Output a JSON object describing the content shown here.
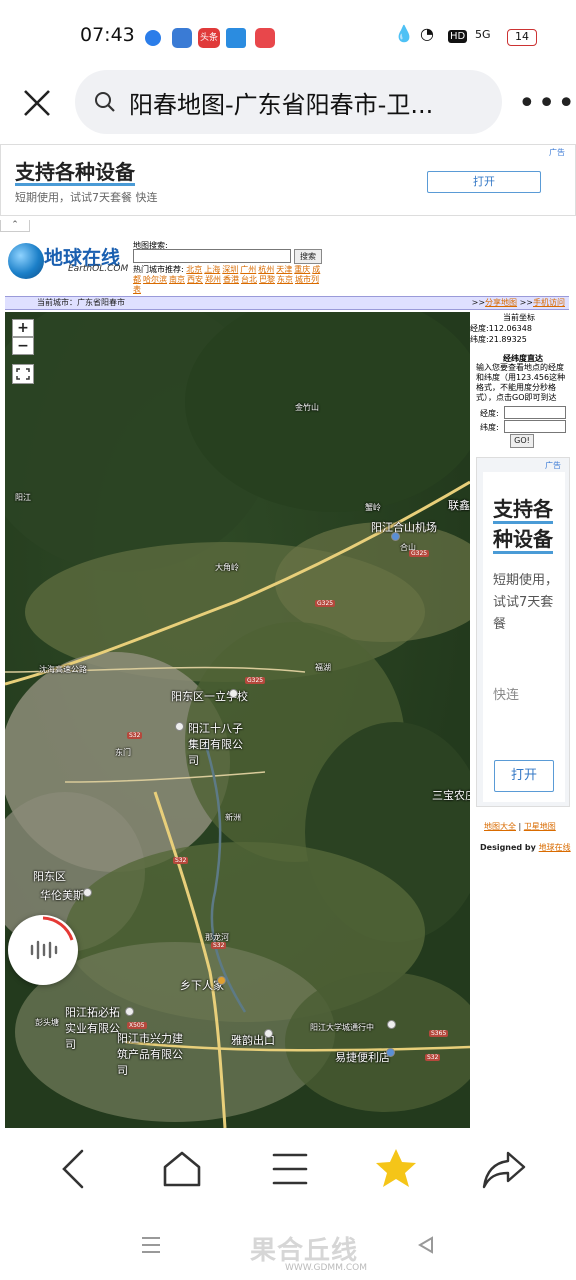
{
  "status_bar": {
    "time": "07:43",
    "headline_badge": "头条",
    "network": "5G",
    "battery": "14",
    "colors": {
      "app1": "#2b7de9",
      "app2": "#3a7bd5",
      "app3": "#e03a3a",
      "app4": "#2b8ce0",
      "app5": "#e8474b"
    }
  },
  "address_bar": {
    "page_title": "阳春地图-广东省阳春市-卫...",
    "icons": [
      "close-icon",
      "search-icon",
      "more-icon"
    ]
  },
  "top_ad": {
    "tag": "广告",
    "heading": "支持各种设备",
    "subtext": "短期使用，试试7天套餐 快连",
    "button": "打开"
  },
  "site": {
    "logo_text": "地球在线",
    "logo_sub": "EarthOL.COM",
    "search_label": "地图搜索:",
    "search_button": "搜索",
    "search_value": "",
    "hot_label": "热门城市推荐:",
    "cities": [
      "北京",
      "上海",
      "深圳",
      "广州",
      "杭州",
      "天津",
      "重庆",
      "成都",
      "哈尔滨",
      "南京",
      "西安",
      "郑州",
      "香港",
      "台北",
      "巴黎",
      "东京",
      "城市列表"
    ],
    "current_city": "当前城市：广东省阳春市",
    "share_link": "分享地图",
    "mobile_link": "手机访问",
    "link_prefix": ">>"
  },
  "side_panel": {
    "coord_title": "当前坐标",
    "lon_text": "经度:112.06348",
    "lat_text": "纬度:21.89325",
    "jump_title": "经纬度直达",
    "jump_desc": "输入您要查看地点的经度和纬度（用123.456这种格式，不能用度分秒格式），点击GO即可到达",
    "lon_label": "经度:",
    "lat_label": "纬度:",
    "lon_value": "",
    "lat_value": "",
    "go_button": "GO!",
    "ad": {
      "tag": "广告",
      "heading": "支持各种设备",
      "subtext": "短期使用，试试7天套餐",
      "brand": "快连",
      "button": "打开"
    },
    "links": [
      "地图大全",
      "卫星地图"
    ],
    "designed_by": "Designed by",
    "designed_link": "地球在线"
  },
  "map": {
    "zoom_in": "+",
    "zoom_out": "−",
    "labels": [
      {
        "text": "阳江合山机场",
        "cls": "big"
      },
      {
        "text": "阳东区一立学校",
        "cls": "big"
      },
      {
        "text": "阳江十八子集团有限公司",
        "cls": "big"
      },
      {
        "text": "阳东区",
        "cls": "big"
      },
      {
        "text": "华伦美斯",
        "cls": "big"
      },
      {
        "text": "乡下人家",
        "cls": "big"
      },
      {
        "text": "阳江拓必拓实业有限公司",
        "cls": "big"
      },
      {
        "text": "阳江市兴力建筑产品有限公司",
        "cls": "big"
      },
      {
        "text": "雅韵出口",
        "cls": "big"
      },
      {
        "text": "阳江大学城通行中",
        "cls": ""
      },
      {
        "text": "易捷便利店",
        "cls": "big"
      },
      {
        "text": "三宝农庄",
        "cls": "big"
      },
      {
        "text": "联鑫",
        "cls": "big"
      },
      {
        "text": "沈海高速公路",
        "cls": ""
      },
      {
        "text": "彭头塘",
        "cls": ""
      },
      {
        "text": "阳江",
        "cls": ""
      },
      {
        "text": "蟹岭",
        "cls": ""
      },
      {
        "text": "大角岭",
        "cls": ""
      },
      {
        "text": "金竹山",
        "cls": ""
      },
      {
        "text": "福湖",
        "cls": ""
      },
      {
        "text": "东门",
        "cls": ""
      },
      {
        "text": "那龙河",
        "cls": ""
      },
      {
        "text": "新洲",
        "cls": ""
      },
      {
        "text": "合山",
        "cls": ""
      }
    ],
    "road_tags": [
      "G325",
      "G325",
      "G325",
      "S32",
      "S32",
      "S32",
      "X505",
      "S365",
      "S32"
    ]
  },
  "bottom_nav": [
    "back-icon",
    "home-icon",
    "menu-icon",
    "favorite-star-icon",
    "share-icon"
  ],
  "watermark": {
    "text": "果合丘线",
    "sub": "WWW.GDMM.COM"
  }
}
